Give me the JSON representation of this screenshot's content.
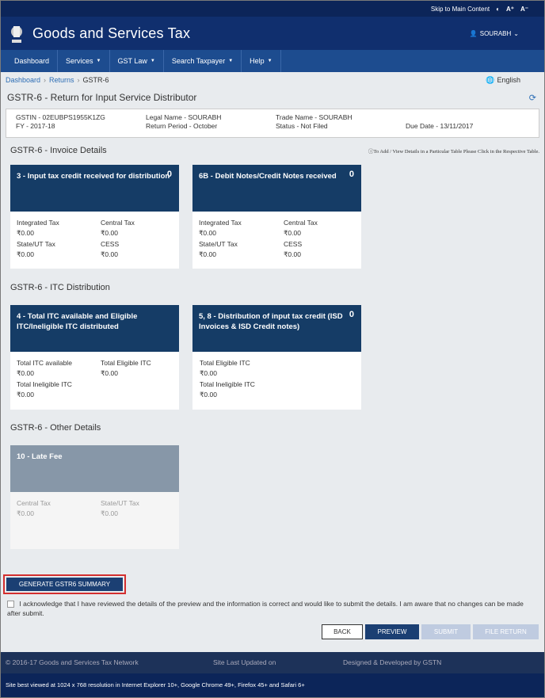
{
  "topbar": {
    "skip": "Skip to Main Content",
    "contrast": "◐",
    "font_up": "A⁺",
    "font_down": "A⁻"
  },
  "header": {
    "title": "Goods and Services Tax",
    "user": "SOURABH"
  },
  "nav": [
    "Dashboard",
    "Services",
    "GST Law",
    "Search Taxpayer",
    "Help"
  ],
  "breadcrumb": {
    "home": "Dashboard",
    "returns": "Returns",
    "current": "GSTR-6",
    "language": "English"
  },
  "return_title": "GSTR-6 - Return for Input Service Distributor",
  "info": {
    "gstin": "GSTIN - 02EUBPS1955K1ZG",
    "fy": "FY - 2017-18",
    "legal_name": "Legal Name - SOURABH",
    "return_period": "Return Period - October",
    "trade_name": "Trade Name - SOURABH",
    "status": "Status - Not Filed",
    "due_date": "Due Date - 13/11/2017"
  },
  "sections": {
    "invoice": "GSTR-6 - Invoice Details",
    "invoice_note": "To Add / View Details in a Particular Table Please Click in the Respective Table.",
    "itc": "GSTR-6 - ITC Distribution",
    "other": "GSTR-6 - Other Details"
  },
  "tiles": {
    "t3": {
      "title": "3 - Input tax credit received for distribution",
      "count": "0",
      "l1": "Integrated Tax",
      "v1": "₹0.00",
      "l2": "Central Tax",
      "v2": "₹0.00",
      "l3": "State/UT Tax",
      "v3": "₹0.00",
      "l4": "CESS",
      "v4": "₹0.00"
    },
    "t6b": {
      "title": "6B - Debit Notes/Credit Notes received",
      "count": "0",
      "l1": "Integrated Tax",
      "v1": "₹0.00",
      "l2": "Central Tax",
      "v2": "₹0.00",
      "l3": "State/UT Tax",
      "v3": "₹0.00",
      "l4": "CESS",
      "v4": "₹0.00"
    },
    "t4": {
      "title": "4 - Total ITC available and Eligible ITC/Ineligible ITC distributed",
      "l1": "Total ITC available",
      "v1": "₹0.00",
      "l2": "Total Eligible ITC",
      "v2": "₹0.00",
      "l3": "Total Ineligible ITC",
      "v3": "₹0.00"
    },
    "t58": {
      "title": "5, 8 - Distribution of input tax credit (ISD Invoices & ISD Credit notes)",
      "count": "0",
      "l1": "Total Eligible ITC",
      "v1": "₹0.00",
      "l2": "Total Ineligible ITC",
      "v2": "₹0.00"
    },
    "t10": {
      "title": "10 - Late Fee",
      "l1": "Central Tax",
      "v1": "₹0.00",
      "l2": "State/UT Tax",
      "v2": "₹0.00"
    }
  },
  "actions": {
    "generate": "GENERATE GSTR6 SUMMARY",
    "ack": "I acknowledge that I have reviewed the details of the preview and the information is correct and would like to submit the details. I am aware that no changes can be made after submit.",
    "back": "BACK",
    "preview": "PREVIEW",
    "submit": "SUBMIT",
    "file": "FILE RETURN"
  },
  "footer": {
    "copyright": "© 2016-17 Goods and Services Tax Network",
    "updated": "Site Last Updated on",
    "designed": "Designed & Developed by GSTN",
    "best_viewed": "Site best viewed at 1024 x 768 resolution in Internet Explorer 10+, Google Chrome 49+, Firefox 45+ and Safari 6+"
  },
  "colors": {
    "header": "#102f6e",
    "nav": "#1d4c8f",
    "tile_head": "#153c66",
    "tile_disabled": "#8797a8",
    "highlight": "#d32f2f"
  }
}
